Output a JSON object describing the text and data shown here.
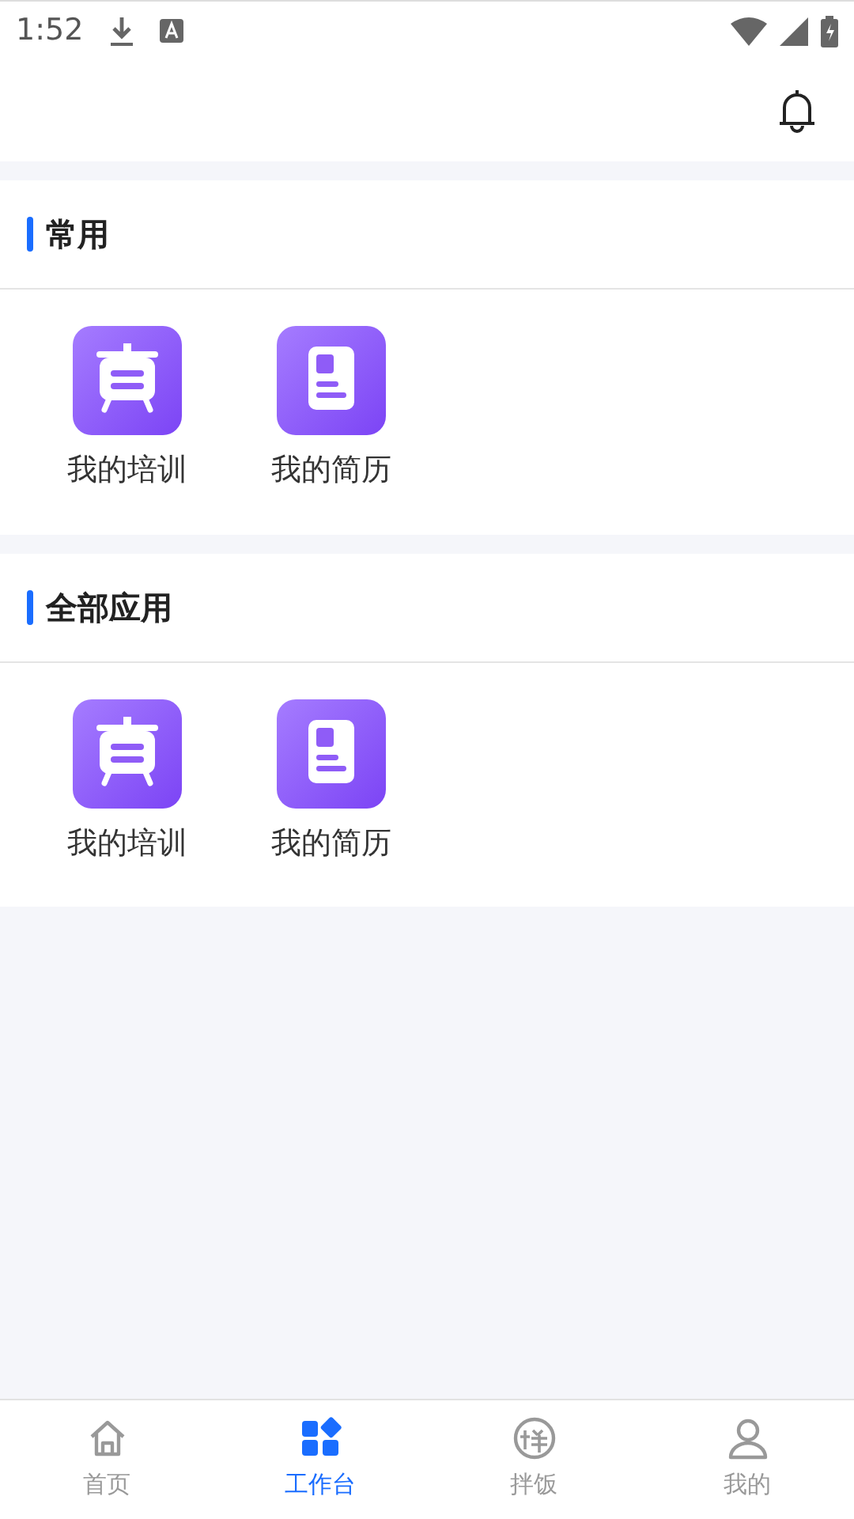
{
  "status_bar": {
    "time": "1:52"
  },
  "sections": [
    {
      "title": "常用",
      "apps": [
        {
          "kind": "training",
          "label": "我的培训"
        },
        {
          "kind": "resume",
          "label": "我的简历"
        }
      ]
    },
    {
      "title": "全部应用",
      "apps": [
        {
          "kind": "training",
          "label": "我的培训"
        },
        {
          "kind": "resume",
          "label": "我的简历"
        }
      ]
    }
  ],
  "tabs": [
    {
      "kind": "home",
      "label": "首页",
      "selected": false
    },
    {
      "kind": "workbench",
      "label": "工作台",
      "selected": true
    },
    {
      "kind": "meal",
      "label": "拌饭",
      "selected": false
    },
    {
      "kind": "profile",
      "label": "我的",
      "selected": false
    }
  ]
}
